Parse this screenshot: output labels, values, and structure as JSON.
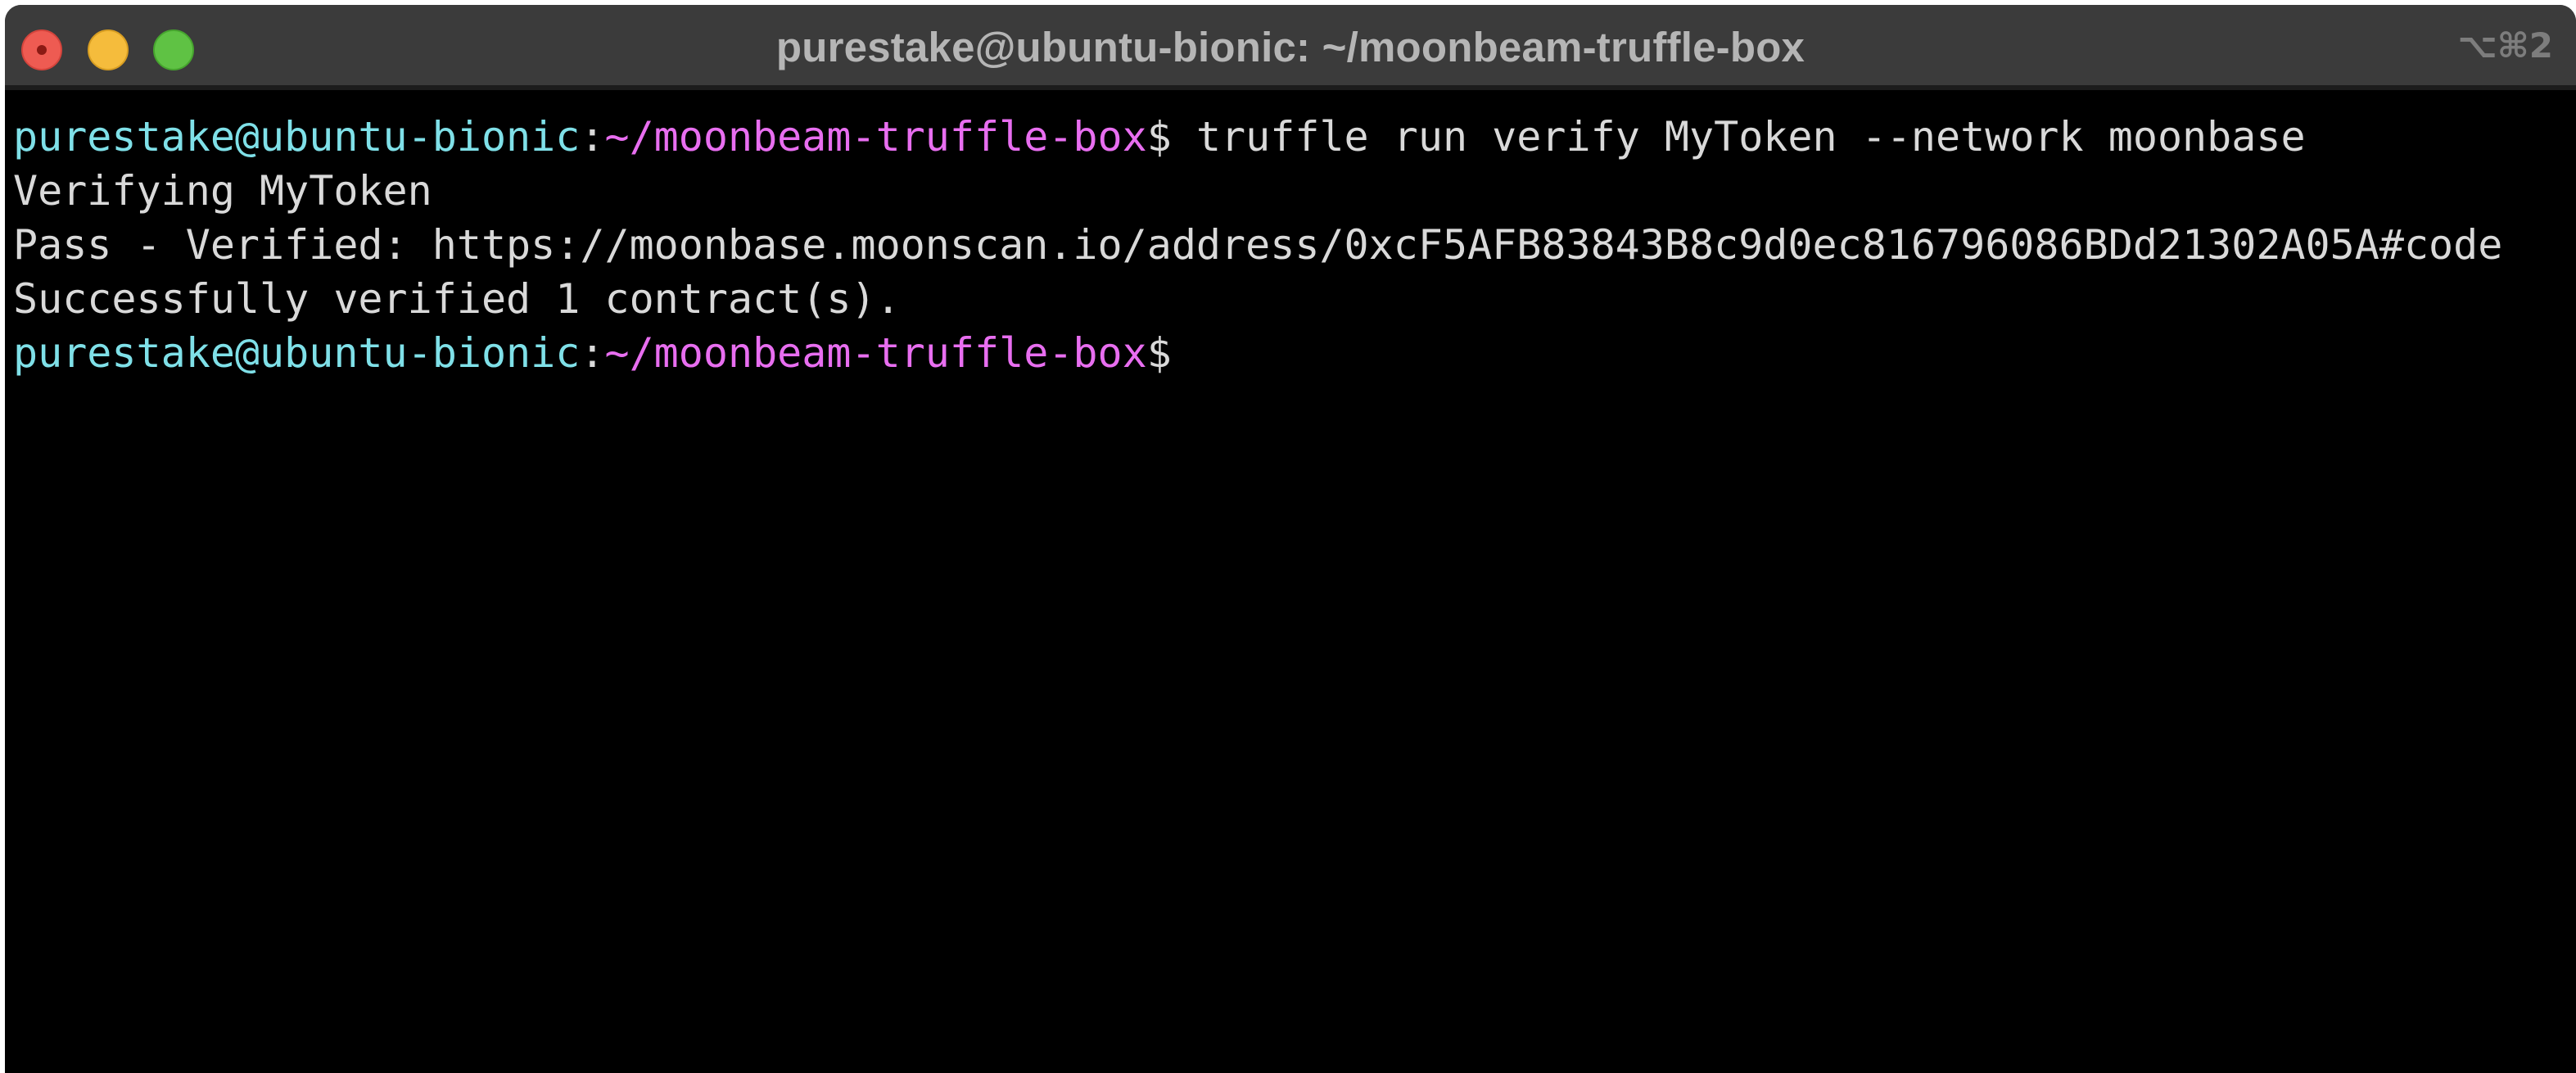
{
  "window": {
    "title": "purestake@ubuntu-bionic: ~/moonbeam-truffle-box",
    "shortcut": "⌥⌘2",
    "colors": {
      "close": "#ee5b52",
      "minimize": "#f5bc3c",
      "zoom": "#5fc244",
      "user": "#7fe0e8",
      "path": "#e86ef0",
      "text": "#d9d9d9",
      "background": "#000000"
    }
  },
  "terminal": {
    "prompt_user": "purestake@ubuntu-bionic",
    "prompt_sep": ":",
    "prompt_path": "~/moonbeam-truffle-box",
    "prompt_symbol": "$",
    "command": " truffle run verify MyToken --network moonbase",
    "output": [
      "Verifying MyToken",
      "Pass - Verified: https://moonbase.moonscan.io/address/0xcF5AFB83843B8c9d0ec816796086BDd21302A05A#code",
      "Successfully verified 1 contract(s)."
    ]
  }
}
